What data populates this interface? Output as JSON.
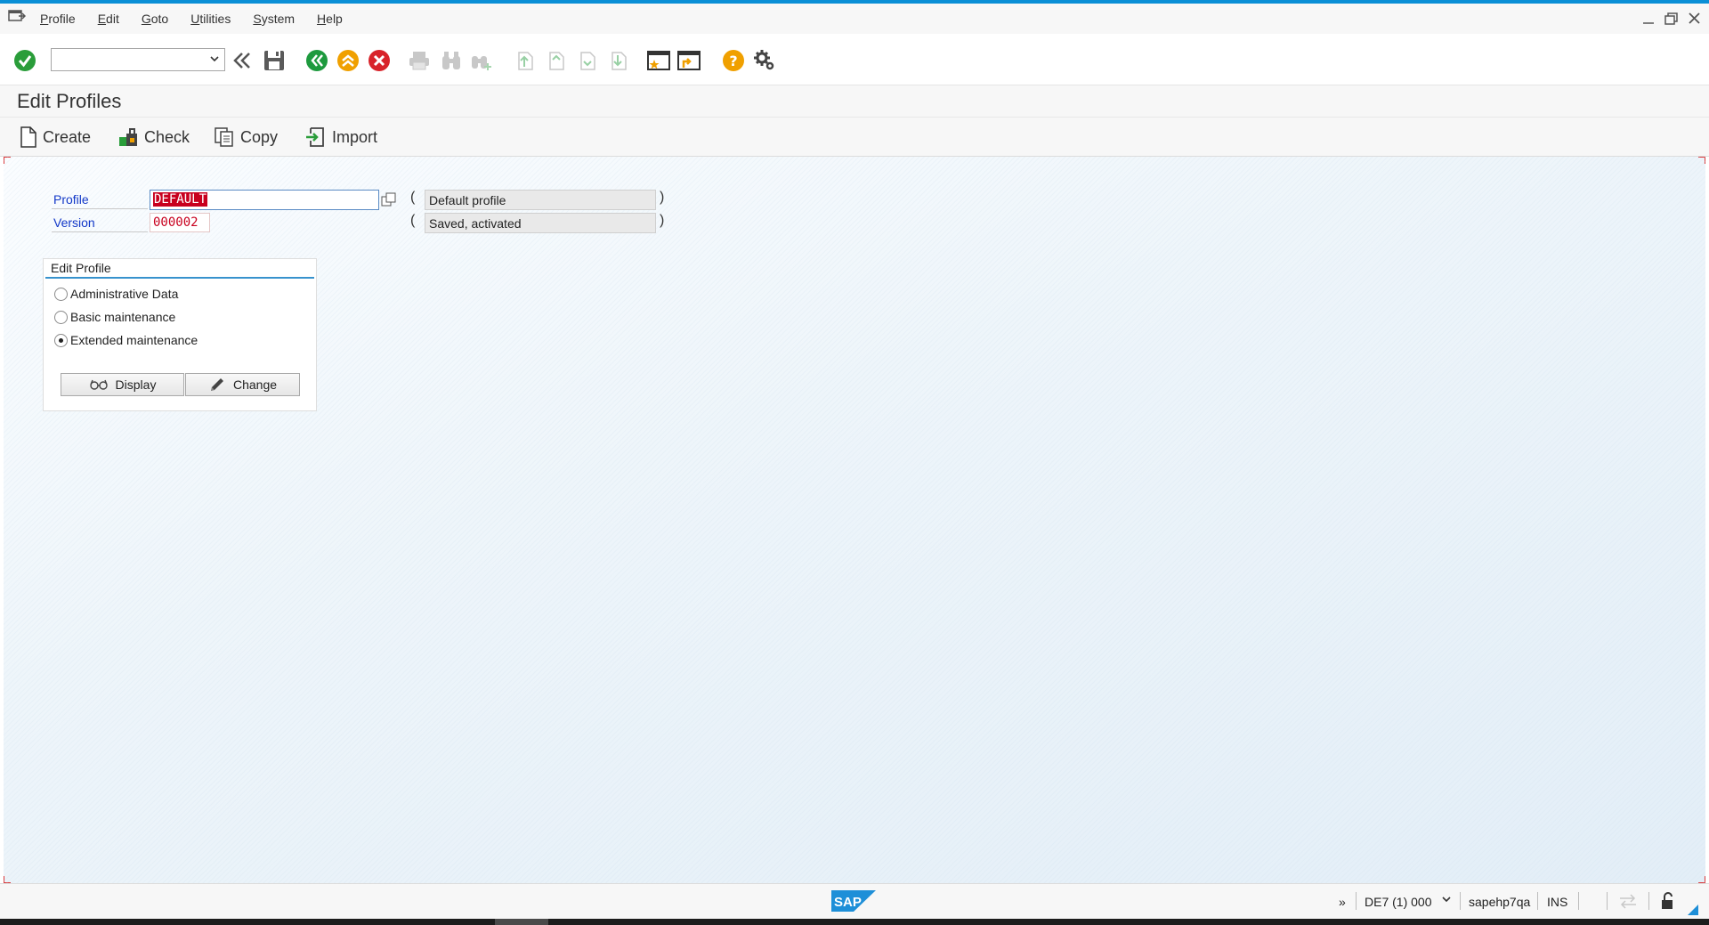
{
  "menu": {
    "items": [
      {
        "u": "P",
        "rest": "rofile"
      },
      {
        "u": "E",
        "rest": "dit"
      },
      {
        "u": "G",
        "rest": "oto"
      },
      {
        "u": "U",
        "rest": "tilities"
      },
      {
        "u": "S",
        "rest": "ystem"
      },
      {
        "u": "H",
        "rest": "elp"
      }
    ]
  },
  "toolbar": {
    "command_value": "",
    "icons": [
      "enter-icon",
      "back-double-icon",
      "save-icon",
      "back-icon",
      "exit-icon",
      "cancel-icon",
      "print-icon",
      "find-icon",
      "find-next-icon",
      "first-page-icon",
      "previous-page-icon",
      "next-page-icon",
      "last-page-icon",
      "new-session-icon",
      "shortcut-icon",
      "help-icon",
      "customize-layout-icon"
    ]
  },
  "page": {
    "title": "Edit Profiles"
  },
  "app_toolbar": {
    "create": "Create",
    "check": "Check",
    "copy": "Copy",
    "import": "Import"
  },
  "form": {
    "profile_label": "Profile",
    "profile_value": "DEFAULT",
    "profile_desc": "Default profile",
    "version_label": "Version",
    "version_value": "000002",
    "version_desc": "Saved, activated",
    "open_paren": "(",
    "close_paren": ")"
  },
  "edit_profile": {
    "title": "Edit Profile",
    "options": [
      "Administrative Data",
      "Basic maintenance",
      "Extended maintenance"
    ],
    "selected": 2,
    "display_label": "Display",
    "change_label": "Change"
  },
  "status": {
    "expand": "»",
    "system": "DE7 (1) 000",
    "host": "sapehp7qa",
    "mode": "INS"
  },
  "colors": {
    "accent": "#0a8fd6",
    "field_label": "#1238c8",
    "error_red": "#c8001e"
  }
}
